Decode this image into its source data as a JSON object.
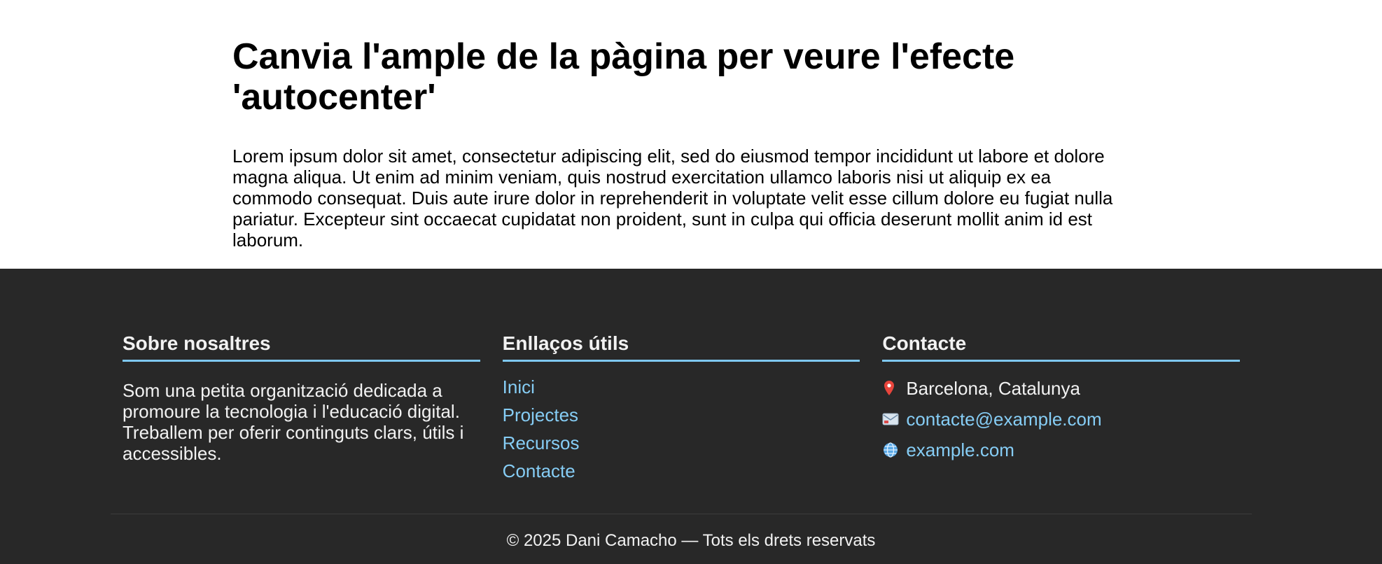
{
  "main": {
    "title": "Canvia l'ample de la pàgina per veure l'efecte 'autocenter'",
    "paragraph": "Lorem ipsum dolor sit amet, consectetur adipiscing elit, sed do eiusmod tempor incididunt ut labore et dolore magna aliqua. Ut enim ad minim veniam, quis nostrud exercitation ullamco laboris nisi ut aliquip ex ea commodo consequat. Duis aute irure dolor in reprehenderit in voluptate velit esse cillum dolore eu fugiat nulla pariatur. Excepteur sint occaecat cupidatat non proident, sunt in culpa qui officia deserunt mollit anim id est laborum."
  },
  "footer": {
    "about": {
      "heading": "Sobre nosaltres",
      "text": "Som una petita organització dedicada a promoure la tecnologia i l'educació digital. Treballem per oferir continguts clars, útils i accessibles."
    },
    "links": {
      "heading": "Enllaços útils",
      "items": [
        "Inici",
        "Projectes",
        "Recursos",
        "Contacte"
      ]
    },
    "contact": {
      "heading": "Contacte",
      "location": "Barcelona, Catalunya",
      "email": "contacte@example.com",
      "website": "example.com",
      "icons": [
        "pin-icon",
        "email-icon",
        "globe-icon"
      ]
    },
    "copyright": "© 2025 Dani Camacho — Tots els drets reservats"
  },
  "colors": {
    "footer_bg": "#282828",
    "accent": "#7ec8f0",
    "link": "#86cdf5"
  }
}
